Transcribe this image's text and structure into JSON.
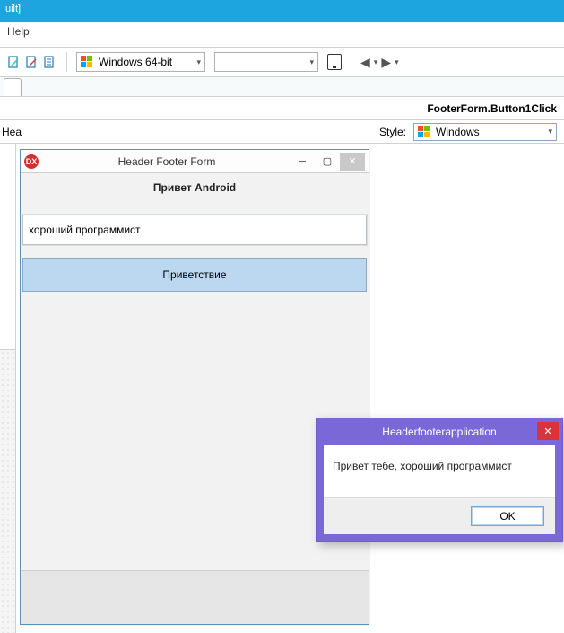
{
  "ide": {
    "title_fragment": "uilt]",
    "menu_help": "Help"
  },
  "toolbar": {
    "platform_label": "Windows 64-bit"
  },
  "tabs": {
    "left_fragment": ""
  },
  "breadcrumb": {
    "tail": "FooterForm.Button1Click"
  },
  "heading": {
    "left_fragment": "Hea",
    "style_label": "Style:",
    "style_value": "Windows"
  },
  "form": {
    "title": "Header Footer Form",
    "header": "Привет Android",
    "input_value": "хороший программист",
    "button_label": "Приветствие"
  },
  "dialog": {
    "title": "Headerfooterapplication",
    "message": "Привет тебе, хороший программист",
    "ok": "OK"
  }
}
